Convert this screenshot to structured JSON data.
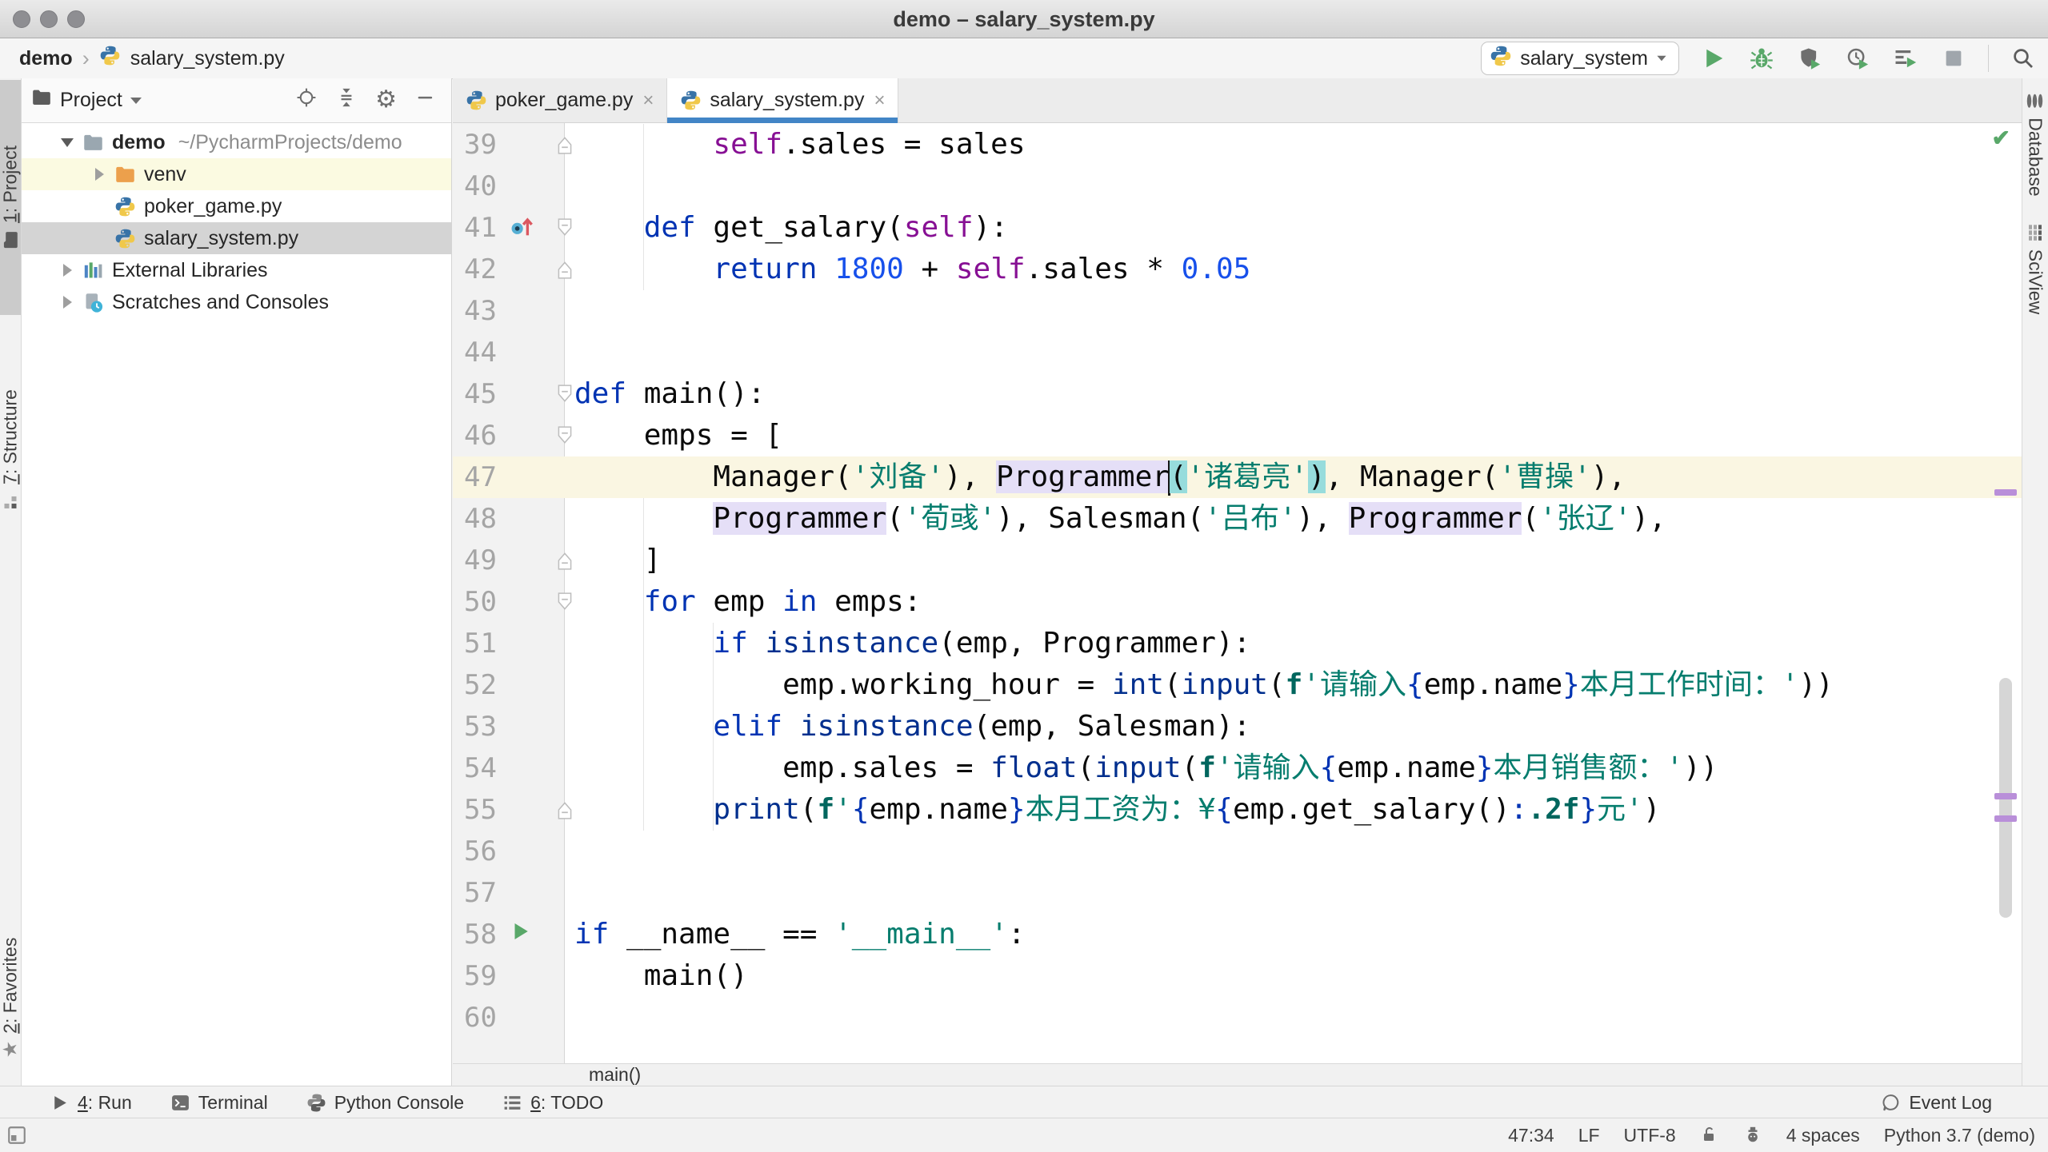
{
  "window": {
    "title": "demo – salary_system.py",
    "traffic_lights": [
      "close-button",
      "minimize-button",
      "zoom-button"
    ]
  },
  "toolbar": {
    "breadcrumbs": {
      "project": "demo",
      "separator": "›",
      "file": "salary_system.py"
    },
    "run_config": {
      "label": "salary_system",
      "icon": "python-icon"
    },
    "actions": [
      {
        "name": "run-button",
        "icon": "run-icon"
      },
      {
        "name": "debug-button",
        "icon": "debug-icon"
      },
      {
        "name": "run-with-coverage-button",
        "icon": "coverage-icon"
      },
      {
        "name": "profile-button",
        "icon": "profiler-icon"
      },
      {
        "name": "concurrency-diagram-button",
        "icon": "concurrency-icon"
      },
      {
        "name": "stop-button",
        "icon": "stop-icon"
      },
      {
        "name": "search-everywhere-button",
        "icon": "search-icon"
      }
    ]
  },
  "project_panel": {
    "title": "Project",
    "header_icons": [
      "locate-icon",
      "collapse-all-icon",
      "settings-gear-icon",
      "hide-panel-icon"
    ],
    "tree": [
      {
        "label": "demo",
        "suffix": "~/PycharmProjects/demo",
        "icon": "folder-icon",
        "expand": "open",
        "level": 0,
        "bold": true
      },
      {
        "label": "venv",
        "icon": "excluded-folder-icon",
        "expand": "closed",
        "level": 1,
        "highlight": true
      },
      {
        "label": "poker_game.py",
        "icon": "python-file-icon",
        "level": 1
      },
      {
        "label": "salary_system.py",
        "icon": "python-file-icon",
        "level": 1,
        "selected": true
      },
      {
        "label": "External Libraries",
        "icon": "libraries-icon",
        "expand": "closed",
        "level": 0
      },
      {
        "label": "Scratches and Consoles",
        "icon": "scratches-icon",
        "expand": "closed",
        "level": 0
      }
    ]
  },
  "tabs": [
    {
      "label": "poker_game.py",
      "icon": "python-file-icon",
      "active": false
    },
    {
      "label": "salary_system.py",
      "icon": "python-file-icon",
      "active": true
    }
  ],
  "stripes": {
    "left": [
      {
        "label": "1: Project",
        "icon": "project-stripe-icon",
        "active": true,
        "mn": true
      },
      {
        "label": "7: Structure",
        "icon": "structure-stripe-icon",
        "mn": true
      }
    ],
    "left_bottom": [
      {
        "label": "2: Favorites",
        "icon": "favorites-star-icon",
        "mn": true
      }
    ],
    "right": [
      {
        "label": "Database",
        "icon": "database-stripe-icon"
      },
      {
        "label": "SciView",
        "icon": "sciview-stripe-icon"
      }
    ]
  },
  "editor": {
    "breadcrumb": "main()",
    "inspection_status": "ok",
    "caret_position": "47:34",
    "lines": [
      {
        "num": 39,
        "fold": "up",
        "tokens": [
          [
            "p",
            "        "
          ],
          [
            "v",
            "self"
          ],
          [
            "p",
            ".sales = sales"
          ]
        ]
      },
      {
        "num": 40,
        "tokens": []
      },
      {
        "num": 41,
        "fold": "down",
        "gutter_icon": "override-icon",
        "tokens": [
          [
            "p",
            "    "
          ],
          [
            "k",
            "def"
          ],
          [
            "p",
            " get_salary("
          ],
          [
            "v",
            "self"
          ],
          [
            "p",
            "):"
          ]
        ]
      },
      {
        "num": 42,
        "fold": "up",
        "tokens": [
          [
            "p",
            "        "
          ],
          [
            "k",
            "return"
          ],
          [
            "p",
            " "
          ],
          [
            "n",
            "1800"
          ],
          [
            "p",
            " + "
          ],
          [
            "v",
            "self"
          ],
          [
            "p",
            ".sales * "
          ],
          [
            "n",
            "0.05"
          ]
        ]
      },
      {
        "num": 43,
        "tokens": []
      },
      {
        "num": 44,
        "tokens": []
      },
      {
        "num": 45,
        "fold": "down",
        "tokens": [
          [
            "k",
            "def"
          ],
          [
            "p",
            " main():"
          ]
        ]
      },
      {
        "num": 46,
        "fold": "down",
        "tokens": [
          [
            "p",
            "    emps = ["
          ]
        ]
      },
      {
        "num": 47,
        "current": true,
        "tokens": [
          [
            "p",
            "        Manager("
          ],
          [
            "s",
            "'刘备'"
          ],
          [
            "p",
            "), "
          ],
          [
            "hl",
            "Programmer"
          ],
          [
            "caret",
            ""
          ],
          [
            "bm",
            "("
          ],
          [
            "s",
            "'诸葛亮'"
          ],
          [
            "bm",
            ")"
          ],
          [
            "p",
            ", Manager("
          ],
          [
            "s",
            "'曹操'"
          ],
          [
            "p",
            "),"
          ]
        ]
      },
      {
        "num": 48,
        "tokens": [
          [
            "p",
            "        "
          ],
          [
            "hl",
            "Programmer"
          ],
          [
            "p",
            "("
          ],
          [
            "s",
            "'荀彧'"
          ],
          [
            "p",
            "), Salesman("
          ],
          [
            "s",
            "'吕布'"
          ],
          [
            "p",
            "), "
          ],
          [
            "hl",
            "Programmer"
          ],
          [
            "p",
            "("
          ],
          [
            "s",
            "'张辽'"
          ],
          [
            "p",
            "),"
          ]
        ]
      },
      {
        "num": 49,
        "fold": "up",
        "tokens": [
          [
            "p",
            "    ]"
          ]
        ]
      },
      {
        "num": 50,
        "fold": "down",
        "tokens": [
          [
            "p",
            "    "
          ],
          [
            "k",
            "for"
          ],
          [
            "p",
            " emp "
          ],
          [
            "k",
            "in"
          ],
          [
            "p",
            " emps:"
          ]
        ]
      },
      {
        "num": 51,
        "tokens": [
          [
            "p",
            "        "
          ],
          [
            "k",
            "if"
          ],
          [
            "p",
            " "
          ],
          [
            "b",
            "isinstance"
          ],
          [
            "p",
            "(emp, Programmer):"
          ]
        ]
      },
      {
        "num": 52,
        "tokens": [
          [
            "p",
            "            emp.working_hour = "
          ],
          [
            "b",
            "int"
          ],
          [
            "p",
            "("
          ],
          [
            "b",
            "input"
          ],
          [
            "p",
            "("
          ],
          [
            "f",
            "f"
          ],
          [
            "s",
            "'请输入"
          ],
          [
            "fb",
            "{"
          ],
          [
            "p",
            "emp.name"
          ],
          [
            "fb",
            "}"
          ],
          [
            "s",
            "本月工作时间：'"
          ],
          [
            "p",
            "))"
          ]
        ]
      },
      {
        "num": 53,
        "tokens": [
          [
            "p",
            "        "
          ],
          [
            "k",
            "elif"
          ],
          [
            "p",
            " "
          ],
          [
            "b",
            "isinstance"
          ],
          [
            "p",
            "(emp, Salesman):"
          ]
        ]
      },
      {
        "num": 54,
        "tokens": [
          [
            "p",
            "            emp.sales = "
          ],
          [
            "b",
            "float"
          ],
          [
            "p",
            "("
          ],
          [
            "b",
            "input"
          ],
          [
            "p",
            "("
          ],
          [
            "f",
            "f"
          ],
          [
            "s",
            "'请输入"
          ],
          [
            "fb",
            "{"
          ],
          [
            "p",
            "emp.name"
          ],
          [
            "fb",
            "}"
          ],
          [
            "s",
            "本月销售额：'"
          ],
          [
            "p",
            "))"
          ]
        ]
      },
      {
        "num": 55,
        "fold": "up",
        "tokens": [
          [
            "p",
            "        "
          ],
          [
            "b",
            "print"
          ],
          [
            "p",
            "("
          ],
          [
            "f",
            "f"
          ],
          [
            "s",
            "'"
          ],
          [
            "fb",
            "{"
          ],
          [
            "p",
            "emp.name"
          ],
          [
            "fb",
            "}"
          ],
          [
            "s",
            "本月工资为：¥"
          ],
          [
            "fb",
            "{"
          ],
          [
            "p",
            "emp.get_salary()"
          ],
          [
            "fb",
            ":"
          ],
          [
            "f",
            ".2f"
          ],
          [
            "fb",
            "}"
          ],
          [
            "s",
            "元'"
          ],
          [
            "p",
            ")"
          ]
        ]
      },
      {
        "num": 56,
        "tokens": []
      },
      {
        "num": 57,
        "tokens": []
      },
      {
        "num": 58,
        "gutter_icon": "run-gutter-icon",
        "tokens": [
          [
            "k",
            "if"
          ],
          [
            "p",
            " __name__ == "
          ],
          [
            "s",
            "'__main__'"
          ],
          [
            "p",
            ":"
          ]
        ]
      },
      {
        "num": 59,
        "tokens": [
          [
            "p",
            "    main()"
          ]
        ]
      },
      {
        "num": 60,
        "tokens": []
      }
    ]
  },
  "bottom_bar": {
    "left": [
      {
        "label": "4: Run",
        "icon": "run-small-icon",
        "mn": true
      },
      {
        "label": "Terminal",
        "icon": "terminal-icon"
      },
      {
        "label": "Python Console",
        "icon": "python-console-icon"
      },
      {
        "label": "6: TODO",
        "icon": "todo-icon",
        "mn": true
      }
    ],
    "right": [
      {
        "label": "Event Log",
        "icon": "event-log-icon"
      }
    ]
  },
  "status_bar": {
    "items": [
      {
        "label": "47:34",
        "name": "caret-position"
      },
      {
        "label": "LF",
        "name": "line-separator"
      },
      {
        "label": "UTF-8",
        "name": "file-encoding"
      },
      {
        "icon": "unlock-icon",
        "name": "readonly-toggle"
      },
      {
        "icon": "inspections-profile-icon",
        "name": "highlighting-level"
      },
      {
        "label": "4 spaces",
        "name": "indent-style"
      },
      {
        "label": "Python 3.7 (demo)",
        "name": "interpreter"
      }
    ]
  },
  "colors": {
    "accent_tab_underline": "#4285C6",
    "keyword": "#0033B3",
    "builtin": "#002F8E",
    "string": "#067D6E",
    "number": "#1750EB",
    "self_param": "#871094",
    "current_line": "#FAF6E2",
    "identifier_highlight": "#E5DFF7",
    "brace_match": "#97DCDC",
    "run_green": "#59A869",
    "error_stripe_mark": "#B98FD9"
  }
}
